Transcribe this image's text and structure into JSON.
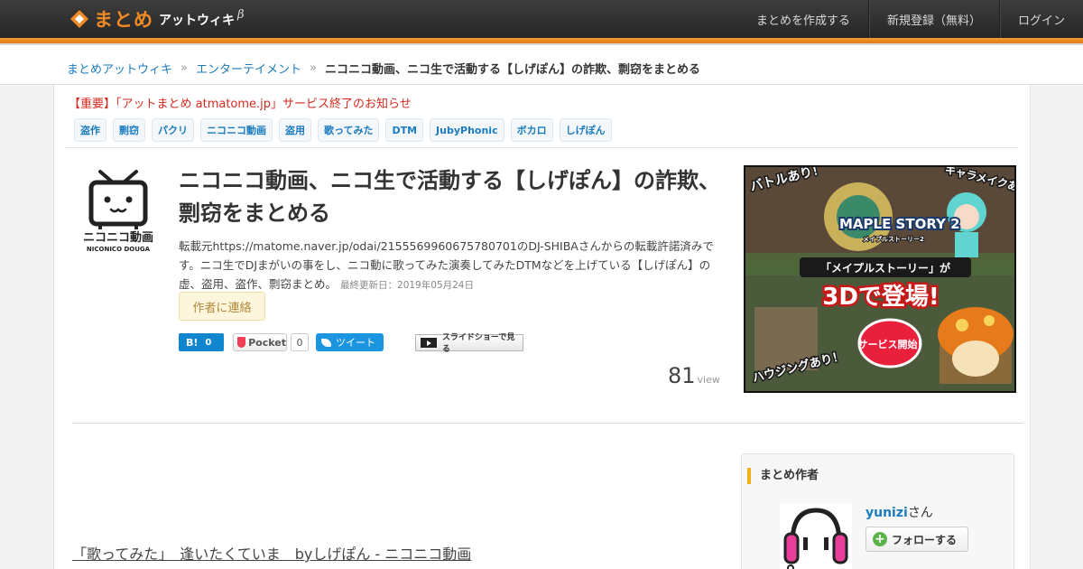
{
  "header": {
    "logo_main": "まとめ",
    "logo_sub": "アットウィキ",
    "logo_beta": "β",
    "nav": [
      "まとめを作成する",
      "新規登録（無料）",
      "ログイン"
    ]
  },
  "breadcrumb": {
    "items": [
      "まとめアットウィキ",
      "エンターテイメント"
    ],
    "separator": "»",
    "current": "ニコニコ動画、ニコ生で活動する【しげぽん】の詐欺、剽窃をまとめる"
  },
  "notice": "【重要】「アットまとめ atmatome.jp」サービス終了のお知らせ",
  "tags": [
    "盗作",
    "剽窃",
    "パクリ",
    "ニコニコ動画",
    "盗用",
    "歌ってみた",
    "DTM",
    "JubyPhonic",
    "ボカロ",
    "しげぽん"
  ],
  "thumbnail": {
    "logo_text": "ニコニコ動画",
    "logo_subtext": "NICONICO DOUGA"
  },
  "article": {
    "title": "ニコニコ動画、ニコ生で活動する【しげぽん】の詐欺、剽窃をまとめる",
    "description": "転載元https://matome.naver.jp/odai/2155569960675780701のDJ-SHIBAさんからの転載許諾済みです。ニコ生でDJまがいの事をし、ニコ動に歌ってみた演奏してみたDTMなどを上げている【しげぽん】の虚、盗用、盗作、剽窃まとめ。",
    "updated": "最終更新日：2019年05月24日",
    "contact_label": "作者に連絡",
    "views": "81",
    "views_label": "view"
  },
  "social": {
    "hatena_label": "B!",
    "hatena_count": "0",
    "pocket_label": "Pocket",
    "pocket_count": "0",
    "tweet_label": "ツイート",
    "slideshow_label": "スライドショーで見る"
  },
  "ad": {
    "text_battle": "バトルあり！",
    "text_chara": "キャラメイクあり！",
    "text_logo": "MAPLE STORY 2",
    "text_logo_sub": "メイプルストーリー2",
    "text_main_1": "「メイプルストーリー」が",
    "text_main_2": "3Dで登場!",
    "text_service": "サービス開始!",
    "text_housing": "ハウジングあり！"
  },
  "video_link": "「歌ってみた」　逢いたくていま　byしげぽん - ニコニコ動画",
  "author": {
    "heading": "まとめ作者",
    "name": "yunizi",
    "honorific": "さん",
    "follow_label": "フォローする"
  },
  "colors": {
    "accent_orange": "#f08a24",
    "link_blue": "#1a7bbf",
    "notice_red": "#d42a1e"
  }
}
